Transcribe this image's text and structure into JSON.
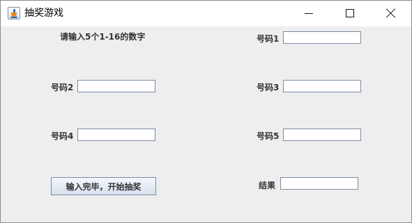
{
  "window": {
    "title": "抽奖游戏",
    "app_icon": "java-coffee-cup-icon",
    "controls": {
      "minimize_icon": "minimize-icon",
      "maximize_icon": "maximize-icon",
      "close_icon": "close-icon"
    }
  },
  "form": {
    "instruction": "请输入5个1-16的数字",
    "number1_label": "号码1",
    "number1_value": "",
    "number2_label": "号码2",
    "number2_value": "",
    "number3_label": "号码3",
    "number3_value": "",
    "number4_label": "号码4",
    "number4_value": "",
    "number5_label": "号码5",
    "number5_value": "",
    "result_label": "结果",
    "result_value": "",
    "start_button": "输入完毕，开始抽奖"
  }
}
